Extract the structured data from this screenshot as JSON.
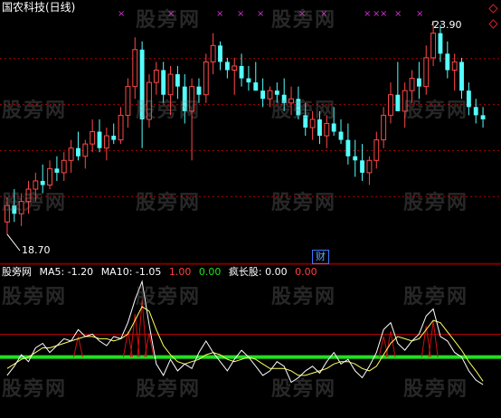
{
  "header": {
    "title": "国农科技(日线)"
  },
  "price_chart": {
    "high_label": "23.90",
    "low_label": "18.70",
    "finance_badge": "财"
  },
  "indicator": {
    "name": "股旁网",
    "ma5": "MA5: -1.20",
    "ma10": "MA10: -1.05",
    "v1": "1.00",
    "v2": "0.00",
    "name2": "疯长股: 0.00",
    "v3": "0.00"
  },
  "watermark": "股旁网",
  "colors": {
    "up": "#ff4848",
    "down": "#54ffff",
    "grid": "#b00000",
    "ma_green": "#20e020",
    "line_white": "#ffffff",
    "line_yellow": "#ffff60",
    "marker": "#d030d0"
  },
  "chart_data": {
    "type": "candlestick",
    "ohlc": [
      [
        19.0,
        19.6,
        18.7,
        19.4
      ],
      [
        19.4,
        19.8,
        19.0,
        19.2
      ],
      [
        19.2,
        19.7,
        18.9,
        19.5
      ],
      [
        19.5,
        20.0,
        19.2,
        19.8
      ],
      [
        19.8,
        20.2,
        19.5,
        20.0
      ],
      [
        20.0,
        20.4,
        19.7,
        19.9
      ],
      [
        19.9,
        20.5,
        19.8,
        20.3
      ],
      [
        20.3,
        20.6,
        20.0,
        20.2
      ],
      [
        20.2,
        20.7,
        20.0,
        20.5
      ],
      [
        20.5,
        21.0,
        20.2,
        20.8
      ],
      [
        20.8,
        21.2,
        20.5,
        20.6
      ],
      [
        20.6,
        21.0,
        20.3,
        20.9
      ],
      [
        20.9,
        21.5,
        20.7,
        21.2
      ],
      [
        21.2,
        21.5,
        20.7,
        20.8
      ],
      [
        20.8,
        21.3,
        20.5,
        21.1
      ],
      [
        21.1,
        21.4,
        20.9,
        21.0
      ],
      [
        21.0,
        21.8,
        20.9,
        21.6
      ],
      [
        21.6,
        22.5,
        21.3,
        22.3
      ],
      [
        22.3,
        23.5,
        22.0,
        23.2
      ],
      [
        23.2,
        23.4,
        20.8,
        21.5
      ],
      [
        21.5,
        22.6,
        21.3,
        22.4
      ],
      [
        22.4,
        22.9,
        22.1,
        22.7
      ],
      [
        22.7,
        22.9,
        21.9,
        22.1
      ],
      [
        22.1,
        22.8,
        21.6,
        22.6
      ],
      [
        22.6,
        22.8,
        22.0,
        22.3
      ],
      [
        22.3,
        22.6,
        21.4,
        21.7
      ],
      [
        21.7,
        22.5,
        20.5,
        22.3
      ],
      [
        22.3,
        22.5,
        21.9,
        22.1
      ],
      [
        22.1,
        23.1,
        21.9,
        22.9
      ],
      [
        22.9,
        23.6,
        22.6,
        23.3
      ],
      [
        23.3,
        23.4,
        22.7,
        22.9
      ],
      [
        22.9,
        23.0,
        22.5,
        22.7
      ],
      [
        22.7,
        23.0,
        22.1,
        22.8
      ],
      [
        22.8,
        23.1,
        22.3,
        22.5
      ],
      [
        22.5,
        22.8,
        22.2,
        22.4
      ],
      [
        22.4,
        22.9,
        22.2,
        22.2
      ],
      [
        22.2,
        22.5,
        21.8,
        22.0
      ],
      [
        22.0,
        22.3,
        21.8,
        22.2
      ],
      [
        22.2,
        22.4,
        21.9,
        22.1
      ],
      [
        22.1,
        22.5,
        21.7,
        21.9
      ],
      [
        21.9,
        22.3,
        21.6,
        22.0
      ],
      [
        22.0,
        22.3,
        21.5,
        21.6
      ],
      [
        21.6,
        21.9,
        21.1,
        21.3
      ],
      [
        21.3,
        21.7,
        21.0,
        21.5
      ],
      [
        21.5,
        21.7,
        20.9,
        21.1
      ],
      [
        21.1,
        21.6,
        20.8,
        21.4
      ],
      [
        21.4,
        21.8,
        21.1,
        21.2
      ],
      [
        21.2,
        21.5,
        20.9,
        21.0
      ],
      [
        21.0,
        21.4,
        20.4,
        20.6
      ],
      [
        20.6,
        21.0,
        20.1,
        20.5
      ],
      [
        20.5,
        20.9,
        20.0,
        20.2
      ],
      [
        20.2,
        20.6,
        19.9,
        20.5
      ],
      [
        20.5,
        21.2,
        20.3,
        21.0
      ],
      [
        21.0,
        21.8,
        20.8,
        21.6
      ],
      [
        21.6,
        22.4,
        21.4,
        22.1
      ],
      [
        22.1,
        22.9,
        21.7,
        21.7
      ],
      [
        21.7,
        22.4,
        21.3,
        22.2
      ],
      [
        22.2,
        22.7,
        21.9,
        22.5
      ],
      [
        22.5,
        22.9,
        22.0,
        22.3
      ],
      [
        22.3,
        23.3,
        22.1,
        23.0
      ],
      [
        23.0,
        23.9,
        22.8,
        23.6
      ],
      [
        23.6,
        23.8,
        22.9,
        23.1
      ],
      [
        23.1,
        23.4,
        22.5,
        22.7
      ],
      [
        22.7,
        23.1,
        22.2,
        22.9
      ],
      [
        22.9,
        23.0,
        22.0,
        22.2
      ],
      [
        22.2,
        22.4,
        21.6,
        21.8
      ],
      [
        21.8,
        22.0,
        21.4,
        21.6
      ],
      [
        21.6,
        21.8,
        21.3,
        21.5
      ]
    ],
    "ylim": [
      18.5,
      24.1
    ],
    "indicator_lines": {
      "ylim": [
        -2.5,
        3.5
      ],
      "upper_level": 1.0,
      "lower_level": 0.0,
      "ma5": [
        -0.8,
        -0.4,
        0.1,
        -0.2,
        0.4,
        0.6,
        0.2,
        0.5,
        0.8,
        0.7,
        1.2,
        0.9,
        1.0,
        0.7,
        0.5,
        0.9,
        0.8,
        1.5,
        2.5,
        3.3,
        1.4,
        -0.3,
        -0.8,
        -0.1,
        -0.6,
        -0.3,
        -0.5,
        0.2,
        0.7,
        0.2,
        -0.2,
        -0.6,
        -0.1,
        0.3,
        0.0,
        -0.4,
        -0.8,
        -0.6,
        -0.2,
        -0.4,
        -1.1,
        -0.9,
        -0.6,
        -0.4,
        -0.7,
        -0.2,
        0.2,
        -0.3,
        -0.1,
        -0.6,
        -0.9,
        -0.4,
        0.2,
        1.2,
        1.5,
        0.6,
        0.3,
        0.7,
        1.0,
        1.8,
        2.1,
        0.9,
        0.7,
        0.2,
        0.0,
        -0.6,
        -1.0,
        -1.2
      ],
      "ma10": [
        -0.5,
        -0.3,
        -0.1,
        0.0,
        0.2,
        0.4,
        0.4,
        0.5,
        0.6,
        0.7,
        0.8,
        0.9,
        0.9,
        0.8,
        0.8,
        0.7,
        0.8,
        1.0,
        1.6,
        2.2,
        2.0,
        1.2,
        0.5,
        0.1,
        -0.2,
        -0.3,
        -0.2,
        -0.1,
        0.1,
        0.2,
        0.1,
        -0.1,
        -0.2,
        -0.1,
        0.0,
        -0.1,
        -0.3,
        -0.5,
        -0.5,
        -0.5,
        -0.6,
        -0.8,
        -0.8,
        -0.7,
        -0.6,
        -0.5,
        -0.3,
        -0.2,
        -0.2,
        -0.3,
        -0.5,
        -0.6,
        -0.4,
        0.1,
        0.6,
        0.9,
        0.8,
        0.7,
        0.8,
        1.2,
        1.6,
        1.5,
        1.1,
        0.7,
        0.3,
        -0.2,
        -0.6,
        -1.05
      ]
    }
  }
}
